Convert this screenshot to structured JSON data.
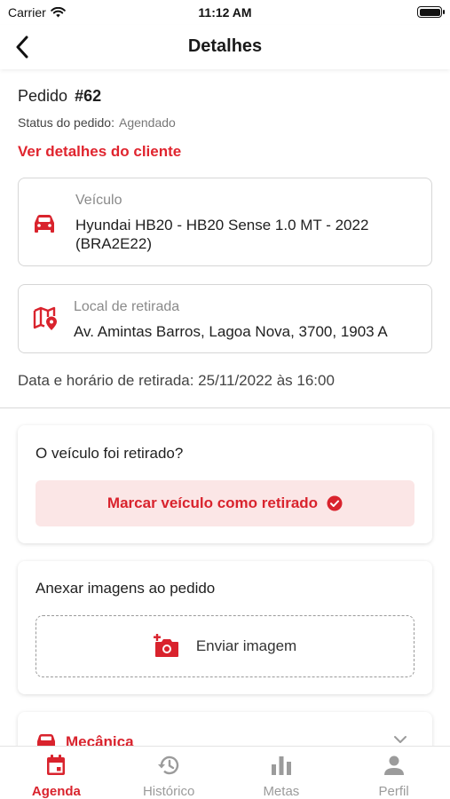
{
  "status_bar": {
    "carrier": "Carrier",
    "time": "11:12 AM"
  },
  "navbar": {
    "title": "Detalhes",
    "back_icon": "chevron-left-icon"
  },
  "order": {
    "label": "Pedido",
    "number": "#62",
    "status_label": "Status do pedido:",
    "status_value": "Agendado",
    "client_link": "Ver detalhes do cliente"
  },
  "vehicle": {
    "icon": "car-icon",
    "label": "Veículo",
    "value_line1": "Hyundai HB20 - HB20 Sense 1.0 MT - 2022",
    "value_line2": "(BRA2E22)"
  },
  "pickup_location": {
    "icon": "map-pin-icon",
    "label": "Local de retirada",
    "value": "Av. Amintas Barros, Lagoa Nova, 3700, 1903 A"
  },
  "pickup_datetime": "Data e horário de retirada: 25/11/2022 às 16:00",
  "pickup_section": {
    "question": "O veículo foi retirado?",
    "button_label": "Marcar veículo como retirado",
    "button_icon": "check-circle-icon"
  },
  "images_section": {
    "title": "Anexar imagens ao pedido",
    "button_label": "Enviar imagem",
    "button_icon": "add-photo-icon"
  },
  "collapsible": {
    "title": "Mecânica",
    "icon": "car-repair-icon",
    "chevron": "chevron-down-icon"
  },
  "tabs": [
    {
      "label": "Agenda",
      "icon": "calendar-icon",
      "active": true
    },
    {
      "label": "Histórico",
      "icon": "history-icon",
      "active": false
    },
    {
      "label": "Metas",
      "icon": "bar-chart-icon",
      "active": false
    },
    {
      "label": "Perfil",
      "icon": "person-icon",
      "active": false
    }
  ],
  "colors": {
    "accent": "#d9232d",
    "accent_light": "#fbe6e6",
    "muted": "#9b9b9b"
  }
}
